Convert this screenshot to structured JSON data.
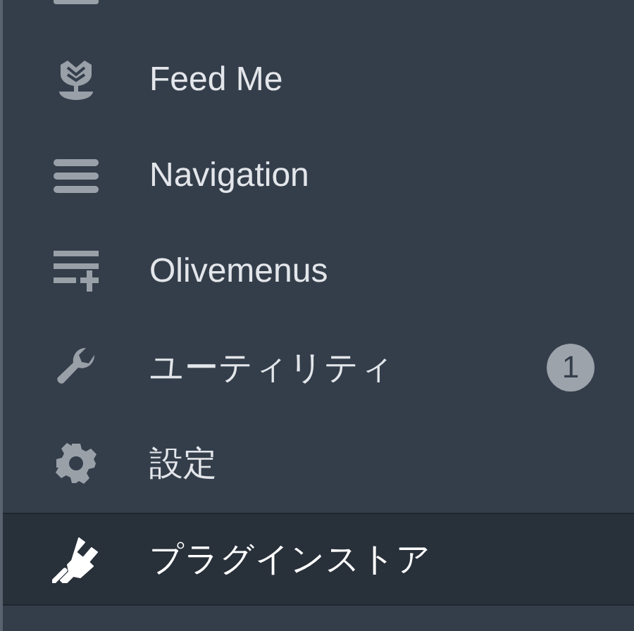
{
  "menu": {
    "items": [
      {
        "kind": "feed",
        "label": "Feed Me",
        "selected": false
      },
      {
        "kind": "navigation",
        "label": "Navigation",
        "selected": false
      },
      {
        "kind": "menus",
        "label": "Olivemenus",
        "selected": false
      },
      {
        "kind": "utility",
        "label": "ユーティリティ",
        "selected": false,
        "badge": "1"
      },
      {
        "kind": "settings",
        "label": "設定",
        "selected": false
      },
      {
        "kind": "plugin",
        "label": "プラグインストア",
        "selected": true
      }
    ]
  }
}
